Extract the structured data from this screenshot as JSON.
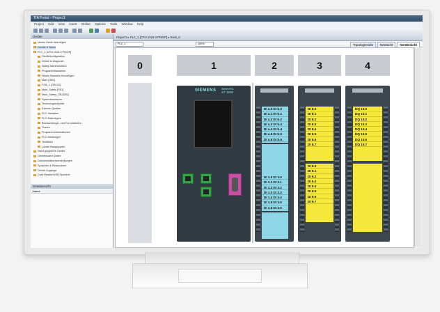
{
  "window": {
    "title": "TIA Portal – Project1",
    "menu_items": [
      "Project",
      "Edit",
      "View",
      "Insert",
      "Online",
      "Options",
      "Tools",
      "Window",
      "Help"
    ]
  },
  "left_pane": {
    "header": "Geräte",
    "tree": [
      {
        "label": "Neues Gerät hinzufügen",
        "selected": false
      },
      {
        "label": "Geräte & Netze",
        "selected": true
      },
      {
        "label": "PLC_1 [CPU 1516-3 PN/DP]",
        "selected": false
      },
      {
        "label": "Gerätekonfiguration",
        "selected": false
      },
      {
        "label": "Online & Diagnose",
        "selected": false
      },
      {
        "label": "Safety Administration",
        "selected": false
      },
      {
        "label": "Programmbausteine",
        "selected": false
      },
      {
        "label": "Neuen Baustein hinzufügen",
        "selected": false
      },
      {
        "label": "Main [OB1]",
        "selected": false
      },
      {
        "label": "FOB_1 [OB123]",
        "selected": false
      },
      {
        "label": "Main_Safety [FB1]",
        "selected": false
      },
      {
        "label": "Main_Safety_DB [DB1]",
        "selected": false
      },
      {
        "label": "Systembausteine",
        "selected": false
      },
      {
        "label": "Technologieobjekte",
        "selected": false
      },
      {
        "label": "Externe Quellen",
        "selected": false
      },
      {
        "label": "PLC-Variablen",
        "selected": false
      },
      {
        "label": "PLC-Datentypen",
        "selected": false
      },
      {
        "label": "Beobachtungs- und Forcetabellen",
        "selected": false
      },
      {
        "label": "Traces",
        "selected": false
      },
      {
        "label": "Programminformationen",
        "selected": false
      },
      {
        "label": "PLC-Meldungen",
        "selected": false
      },
      {
        "label": "Textlisten",
        "selected": false
      },
      {
        "label": "Lokale Baugruppen",
        "selected": false
      },
      {
        "label": "Nicht gruppierte Geräte",
        "selected": false
      },
      {
        "label": "Gemeinsame Daten",
        "selected": false
      },
      {
        "label": "Dokumentationseinstellungen",
        "selected": false
      },
      {
        "label": "Sprachen & Ressourcen",
        "selected": false
      },
      {
        "label": "Online-Zugänge",
        "selected": false
      },
      {
        "label": "Card Reader/USB-Speicher",
        "selected": false
      }
    ],
    "detail_header": "Detailansicht",
    "detail_column": "Name"
  },
  "editor": {
    "breadcrumb": "Project1 ▸ PLC_1 [CPU 1516-3 PN/DP] ▸ Rack_0",
    "device_select": "PLC_1",
    "zoom": "100%",
    "view_tabs": [
      "Topologiesicht",
      "Netzsicht",
      "Gerätesicht"
    ],
    "active_view": "Gerätesicht"
  },
  "rack": {
    "slots": [
      "0",
      "1",
      "2",
      "3",
      "4"
    ],
    "cpu": {
      "brand": "SIEMENS",
      "model_line1": "SIMATIC",
      "model_line2": "S7-1500"
    },
    "module2": {
      "top": [
        "DI a.0",
        "DI a.1",
        "DI a.2",
        "DI a.3",
        "DI a.4",
        "DI a.5",
        "DI a.6",
        "DI a.7"
      ],
      "top_right": [
        "DI b.0",
        "DI b.1",
        "DI b.2",
        "DI b.3",
        "DI b.4",
        "DI b.5",
        "DI b.6",
        "DI b.7"
      ],
      "bottom": [
        "DI 1.0",
        "DI 1.1",
        "DI 1.2",
        "DI 1.3",
        "DI 1.4",
        "DI 1.5",
        "DI 1.6",
        "DI 1.7"
      ],
      "bottom_right": [
        "DI 3.0",
        "DI 3.1",
        "DI 3.2",
        "DI 3.3",
        "DI 3.4",
        "DI 3.5",
        "DI 3.6",
        "DI 3.7"
      ]
    },
    "module3": {
      "top": [
        "DI 8.0",
        "DI 8.1",
        "DI 8.2",
        "DI 8.3",
        "DI 8.4",
        "DI 8.5",
        "DI 8.6",
        "DI 8.7"
      ],
      "bottom": [
        "DI 9.0",
        "DI 9.1",
        "DI 9.2",
        "DI 9.3",
        "DI 9.4",
        "DI 9.5",
        "DI 9.6",
        "DI 9.7"
      ]
    },
    "module4": {
      "top": [
        "DQ 10.0",
        "DQ 10.1",
        "DQ 10.2",
        "DQ 10.3",
        "DQ 10.4",
        "DQ 10.5",
        "DQ 10.6",
        "DQ 10.7"
      ]
    }
  }
}
